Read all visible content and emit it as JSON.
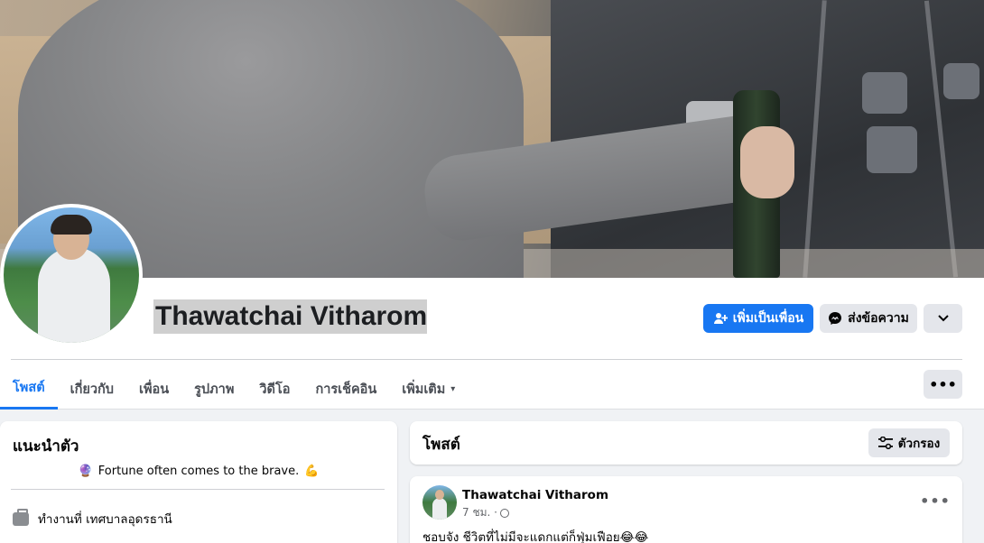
{
  "profile": {
    "name": "Thawatchai Vitharom"
  },
  "actions": {
    "add_friend": "เพิ่มเป็นเพื่อน",
    "message": "ส่งข้อความ",
    "more": "⌄"
  },
  "tabs": [
    {
      "label": "โพสต์",
      "active": true
    },
    {
      "label": "เกี่ยวกับ"
    },
    {
      "label": "เพื่อน"
    },
    {
      "label": "รูปภาพ"
    },
    {
      "label": "วิดีโอ"
    },
    {
      "label": "การเช็คอิน"
    },
    {
      "label": "เพิ่มเติม",
      "caret": "▾"
    }
  ],
  "tabs_more": "•••",
  "intro": {
    "title": "แนะนำตัว",
    "bio": "Fortune often comes to the brave.",
    "bio_emoji_left": "🔮",
    "bio_emoji_right": "💪",
    "work": "ทำงานที่ เทศบาลอุดรธานี"
  },
  "posts": {
    "title": "โพสต์",
    "filter_label": "ตัวกรอง"
  },
  "post": {
    "author": "Thawatchai Vitharom",
    "time": "7 ชม. ·",
    "menu": "•••",
    "text": "ชอบจัง ชีวิตที่ไม่มีจะแดกแต่ก็ฟุ่มเฟือย😂😂"
  },
  "colors": {
    "accent": "#1877f2",
    "button_gray": "#e4e6eb",
    "background": "#f0f2f5"
  }
}
